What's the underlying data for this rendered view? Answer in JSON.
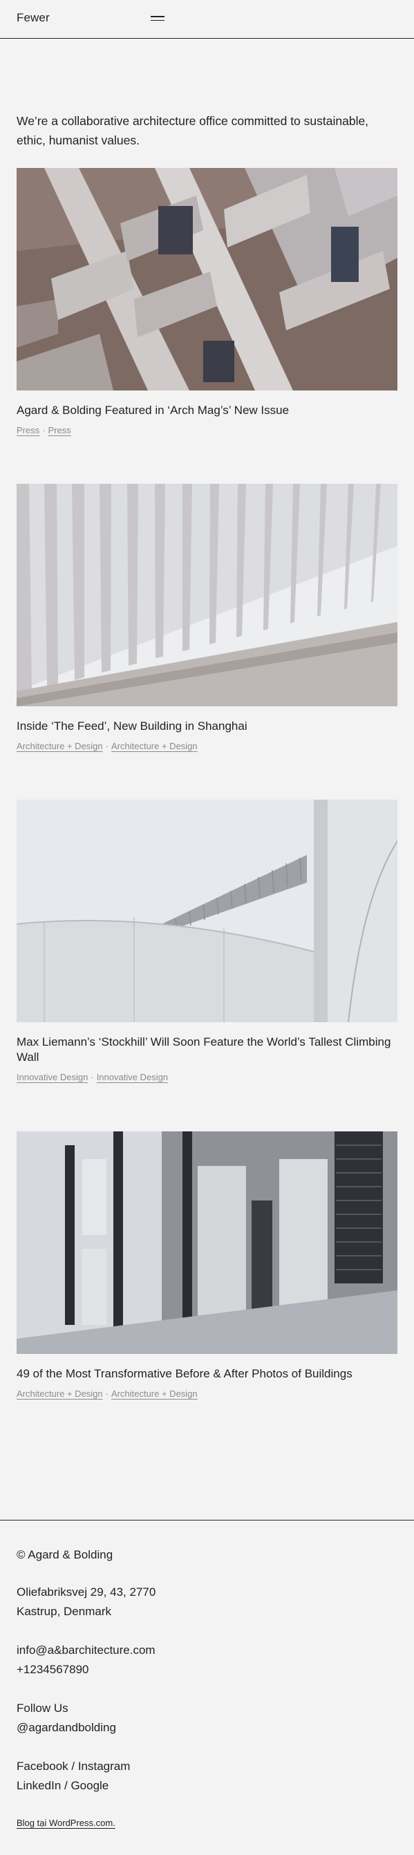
{
  "header": {
    "site_title": "Fewer"
  },
  "intro": "We’re a collaborative architecture office committed to sustainable, ethic, humanist values.",
  "posts": [
    {
      "title": "Agard & Bolding Featured in ‘Arch Mag’s’ New Issue",
      "categories": [
        "Press",
        "Press"
      ]
    },
    {
      "title": "Inside ‘The Feed’, New Building in Shanghai",
      "categories": [
        "Architecture + Design",
        "Architecture + Design"
      ]
    },
    {
      "title": "Max Liemann’s ‘Stockhill’ Will Soon Feature the World’s Tallest Climbing Wall",
      "categories": [
        "Innovative Design",
        "Innovative Design"
      ]
    },
    {
      "title": "49 of the Most Transformative Before & After Photos of Buildings",
      "categories": [
        "Architecture + Design",
        "Architecture + Design"
      ]
    }
  ],
  "meta_separator": "·",
  "footer": {
    "copyright": "© Agard & Bolding",
    "address_line1": "Oliefabriksvej 29, 43, 2770",
    "address_line2": "Kastrup, Denmark",
    "email": "info@a&barchitecture.com",
    "phone": "+1234567890",
    "follow_label": "Follow Us",
    "handle": "@agardandbolding",
    "social_line1": "Facebook / Instagram",
    "social_line2": "LinkedIn / Google",
    "powered_by": "Blog tại WordPress.com."
  }
}
